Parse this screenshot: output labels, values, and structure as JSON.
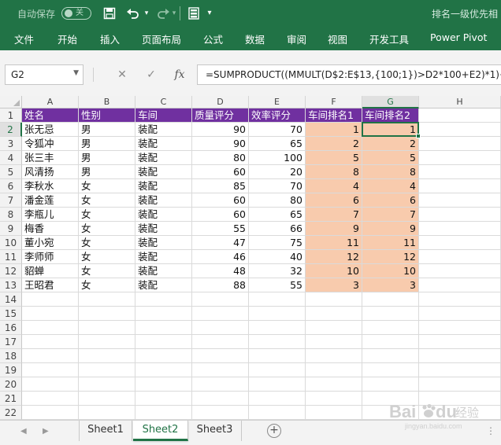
{
  "titlebar": {
    "autosave_label": "自动保存",
    "autosave_state": "关",
    "doc_title": "排名一级优先相"
  },
  "ribbon": {
    "tabs": [
      "文件",
      "开始",
      "插入",
      "页面布局",
      "公式",
      "数据",
      "审阅",
      "视图",
      "开发工具",
      "Power Pivot"
    ]
  },
  "formula_bar": {
    "name_box": "G2",
    "formula": "=SUMPRODUCT((MMULT(D$2:E$13,{100;1})>D2*100+E2)*1)+1"
  },
  "grid": {
    "columns": [
      "A",
      "B",
      "C",
      "D",
      "E",
      "F",
      "G",
      "H"
    ],
    "rows": [
      "1",
      "2",
      "3",
      "4",
      "5",
      "6",
      "7",
      "8",
      "9",
      "10",
      "11",
      "12",
      "13",
      "14",
      "15",
      "16",
      "17",
      "18",
      "19",
      "20",
      "21",
      "22"
    ],
    "header": [
      "姓名",
      "性别",
      "车间",
      "质量评分",
      "效率评分",
      "车间排名1",
      "车间排名2"
    ],
    "data": [
      [
        "张无忌",
        "男",
        "装配",
        "90",
        "70",
        "1",
        "1"
      ],
      [
        "令狐冲",
        "男",
        "装配",
        "90",
        "65",
        "2",
        "2"
      ],
      [
        "张三丰",
        "男",
        "装配",
        "80",
        "100",
        "5",
        "5"
      ],
      [
        "风清扬",
        "男",
        "装配",
        "60",
        "20",
        "8",
        "8"
      ],
      [
        "李秋水",
        "女",
        "装配",
        "85",
        "70",
        "4",
        "4"
      ],
      [
        "潘金莲",
        "女",
        "装配",
        "60",
        "80",
        "6",
        "6"
      ],
      [
        "李瓶儿",
        "女",
        "装配",
        "60",
        "65",
        "7",
        "7"
      ],
      [
        "梅香",
        "女",
        "装配",
        "55",
        "66",
        "9",
        "9"
      ],
      [
        "董小宛",
        "女",
        "装配",
        "47",
        "75",
        "11",
        "11"
      ],
      [
        "李师师",
        "女",
        "装配",
        "46",
        "40",
        "12",
        "12"
      ],
      [
        "貂蝉",
        "女",
        "装配",
        "48",
        "32",
        "10",
        "10"
      ],
      [
        "王昭君",
        "女",
        "装配",
        "88",
        "55",
        "3",
        "3"
      ]
    ],
    "header_fill": "#7030a0",
    "rank_fill": "#f8cbad",
    "selected_cell": "G2"
  },
  "sheet_tabs": {
    "tabs": [
      "Sheet1",
      "Sheet2",
      "Sheet3"
    ],
    "active": "Sheet2"
  },
  "watermark": {
    "brand_1": "Bai",
    "brand_2": "du",
    "brand_3": "经验",
    "url": "jingyan.baidu.com"
  }
}
